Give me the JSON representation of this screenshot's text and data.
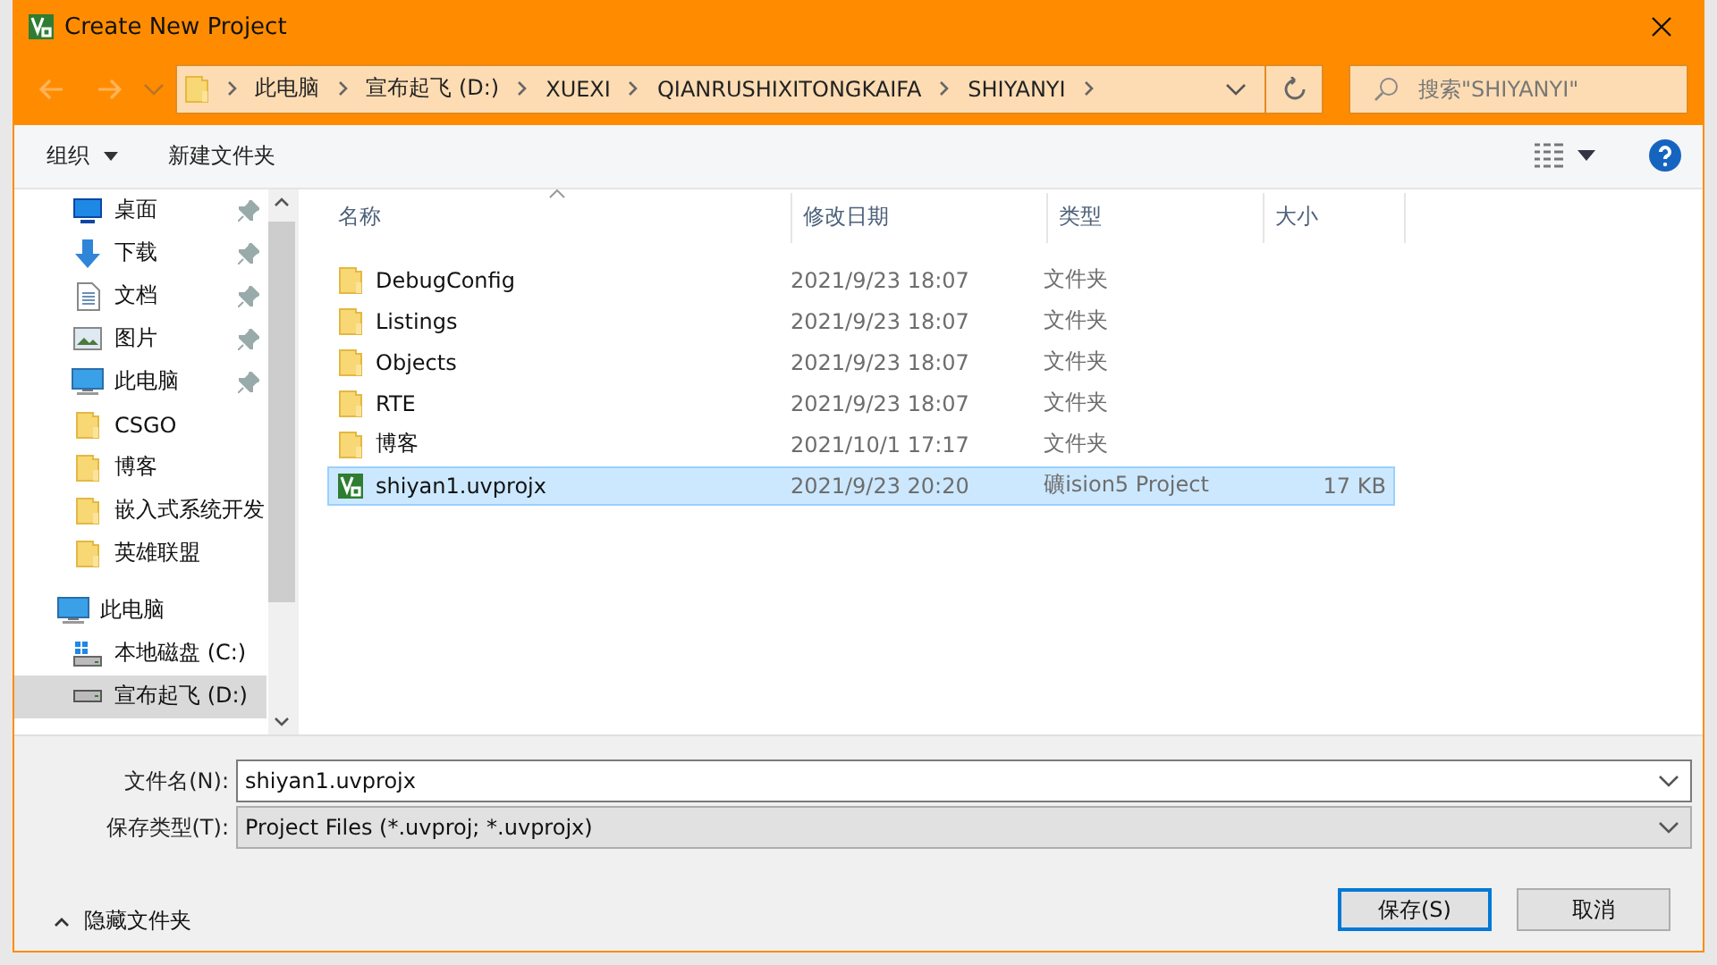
{
  "window": {
    "title": "Create New Project"
  },
  "address": {
    "path": [
      "此电脑",
      "宣布起飞 (D:)",
      "XUEXI",
      "QIANRUSHIXITONGKAIFA",
      "SHIYANYI"
    ]
  },
  "search": {
    "placeholder": "搜索\"SHIYANYI\""
  },
  "toolbar": {
    "organize": "组织",
    "new_folder": "新建文件夹"
  },
  "nav": {
    "items": [
      {
        "label": "桌面",
        "kind": "desktop",
        "pinned": true,
        "selected": false
      },
      {
        "label": "下载",
        "kind": "download",
        "pinned": true,
        "selected": false
      },
      {
        "label": "文档",
        "kind": "document",
        "pinned": true,
        "selected": false
      },
      {
        "label": "图片",
        "kind": "picture",
        "pinned": true,
        "selected": false
      },
      {
        "label": "此电脑",
        "kind": "computer",
        "pinned": true,
        "selected": false
      },
      {
        "label": "CSGO",
        "kind": "folder",
        "pinned": false,
        "selected": false
      },
      {
        "label": "博客",
        "kind": "folder",
        "pinned": false,
        "selected": false
      },
      {
        "label": "嵌入式系统开发",
        "kind": "folder",
        "pinned": false,
        "selected": false
      },
      {
        "label": "英雄联盟",
        "kind": "folder",
        "pinned": false,
        "selected": false
      },
      {
        "label": "此电脑",
        "kind": "computer",
        "pinned": false,
        "selected": false,
        "children": [
          {
            "label": "本地磁盘 (C:)",
            "kind": "system-drive",
            "pinned": false,
            "selected": false
          },
          {
            "label": "宣布起飞 (D:)",
            "kind": "drive",
            "pinned": false,
            "selected": true
          }
        ]
      }
    ]
  },
  "table": {
    "columns": [
      "名称",
      "修改日期",
      "类型",
      "大小"
    ],
    "rows": [
      {
        "name": "DebugConfig",
        "date": "2021/9/23 18:07",
        "type": "文件夹",
        "kind": "folder",
        "selected": false
      },
      {
        "name": "Listings",
        "date": "2021/9/23 18:07",
        "type": "文件夹",
        "kind": "folder",
        "selected": false
      },
      {
        "name": "Objects",
        "date": "2021/9/23 18:07",
        "type": "文件夹",
        "kind": "folder",
        "selected": false
      },
      {
        "name": "RTE",
        "date": "2021/9/23 18:07",
        "type": "文件夹",
        "kind": "folder",
        "selected": false
      },
      {
        "name": "博客",
        "date": "2021/10/1 17:17",
        "type": "文件夹",
        "kind": "folder",
        "selected": false
      },
      {
        "name": "shiyan1.uvprojx",
        "date": "2021/9/23 20:20",
        "type": "礦ision5 Project",
        "size": "17 KB",
        "kind": "project",
        "selected": true
      }
    ]
  },
  "footer": {
    "file_name": {
      "label": "文件名(N):",
      "value": "shiyan1.uvprojx"
    },
    "file_type": {
      "label": "保存类型(T):",
      "value": "Project Files (*.uvproj; *.uvprojx)"
    },
    "hide_folders": "隐藏文件夹",
    "buttons": [
      {
        "label": "保存(S)",
        "default": true
      },
      {
        "label": "取消",
        "default": false
      }
    ]
  }
}
